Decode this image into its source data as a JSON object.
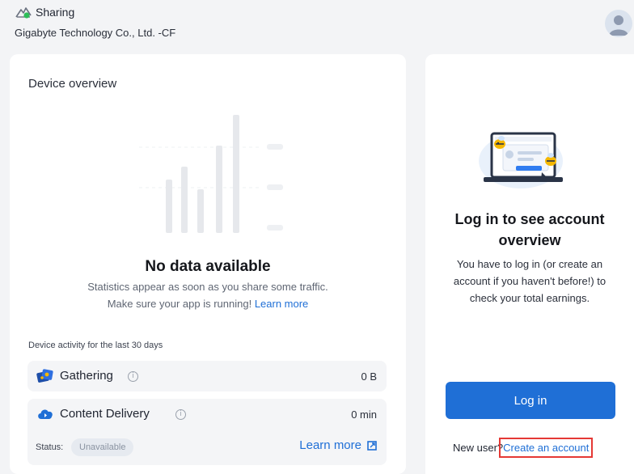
{
  "header": {
    "status_text": "Sharing",
    "device_name": "Gigabyte Technology Co., Ltd. -CF"
  },
  "device_overview": {
    "title": "Device overview",
    "empty_title": "No data available",
    "empty_line1": "Statistics appear as soon as you share some traffic.",
    "empty_line2_prefix": "Make sure your app is running!",
    "empty_link": "Learn more",
    "activity_label": "Device activity for the last 30 days",
    "gathering": {
      "label": "Gathering",
      "value": "0 B",
      "icon": "gathering-icon"
    },
    "content_delivery": {
      "label": "Content Delivery",
      "value": "0 min",
      "icon": "cloud-icon",
      "status_label": "Status:",
      "status_value": "Unavailable",
      "learn_more": "Learn more"
    }
  },
  "account_panel": {
    "title": "Log in to see account overview",
    "description": "You have to log in (or create an account if you haven't before!) to check your total earnings.",
    "login_button": "Log in",
    "new_user_prefix": "New user?",
    "create_account_link": "Create an account"
  },
  "colors": {
    "accent": "#1f6fd6",
    "highlight": "#e53935",
    "status_green": "#2ebd59"
  }
}
